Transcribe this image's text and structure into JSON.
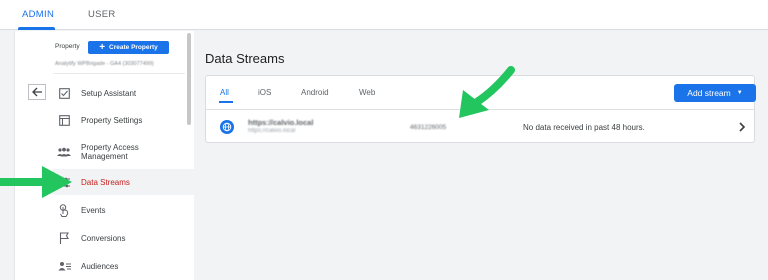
{
  "top_tabs": [
    {
      "label": "ADMIN",
      "active": true
    },
    {
      "label": "USER",
      "active": false
    }
  ],
  "sidebar": {
    "property_label": "Property",
    "create_button": "Create Property",
    "account_line": "Analytify WPBrigade - GA4 (303077499)",
    "items": [
      {
        "label": "Setup Assistant",
        "icon": "checkbox-icon"
      },
      {
        "label": "Property Settings",
        "icon": "settings-box-icon"
      },
      {
        "label": "Property Access Management",
        "icon": "people-icon"
      },
      {
        "label": "Data Streams",
        "icon": "data-streams-icon",
        "active": true
      },
      {
        "label": "Events",
        "icon": "touch-icon"
      },
      {
        "label": "Conversions",
        "icon": "flag-icon"
      },
      {
        "label": "Audiences",
        "icon": "audience-icon"
      }
    ]
  },
  "main": {
    "title": "Data Streams",
    "tabs": [
      {
        "label": "All",
        "active": true
      },
      {
        "label": "iOS"
      },
      {
        "label": "Android"
      },
      {
        "label": "Web"
      }
    ],
    "add_stream_button": "Add stream",
    "stream": {
      "name": "https://calvio.local",
      "url": "https://calvio.local",
      "id": "4631226005",
      "status": "No data received in past 48 hours."
    }
  },
  "colors": {
    "accent": "#1a73e8",
    "active_nav_text": "#c5221f",
    "arrow_green": "#22c55e"
  }
}
